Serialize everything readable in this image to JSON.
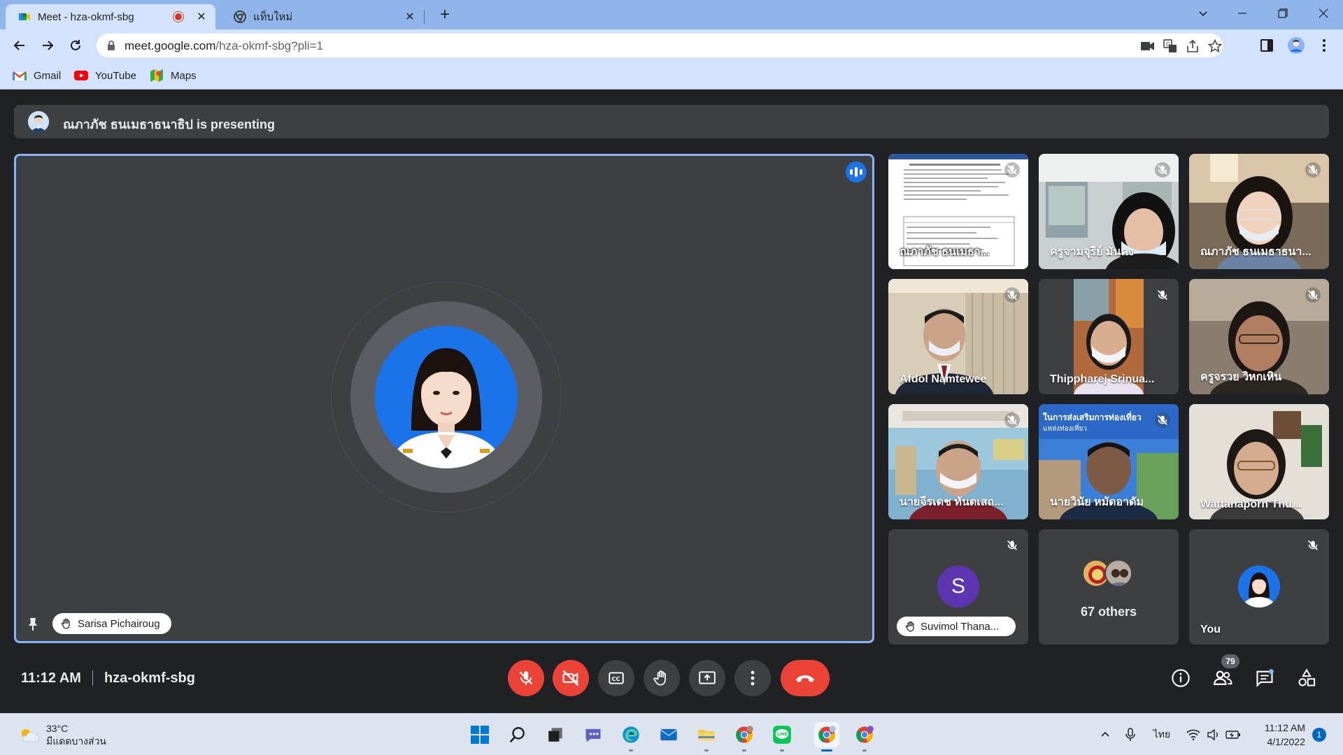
{
  "browser": {
    "tabs": [
      {
        "title": "Meet - hza-okmf-sbg",
        "active": true,
        "recording": true
      },
      {
        "title": "แท็บใหม่",
        "active": false
      }
    ],
    "url_host": "meet.google.com",
    "url_path": "/hza-okmf-sbg?pli=1",
    "bookmarks": [
      "Gmail",
      "YouTube",
      "Maps"
    ]
  },
  "meet": {
    "presenting_text": "ณภาภัช ธนเมธาธนาธิป is presenting",
    "main_speaker": "Sarisa Pichairoug",
    "tiles": [
      {
        "name": "ณภาภัช ธนเมธา...",
        "kind": "screen"
      },
      {
        "name": "ครูจามจุรีย์ มั่นคง",
        "kind": "video"
      },
      {
        "name": "ณภาภัช ธนเมธาธนา...",
        "kind": "video"
      },
      {
        "name": "Afdol Namtewee",
        "kind": "video"
      },
      {
        "name": "Thippharej Srinua...",
        "kind": "video"
      },
      {
        "name": "ครูจรวย วิหกเหิน",
        "kind": "video"
      },
      {
        "name": "นายจีรเดช ทันตเสถ...",
        "kind": "video"
      },
      {
        "name": "นายวินัย หมัดอาดัม",
        "kind": "video"
      },
      {
        "name": "Wattanaporn Thu...",
        "kind": "video"
      },
      {
        "name": "Suvimol Thana...",
        "kind": "avatar",
        "initial": "S"
      },
      {
        "name": "67 others",
        "kind": "others"
      },
      {
        "name": "You",
        "kind": "self"
      }
    ],
    "banner_text": "ในการส่งเสริมการท่องเที่ยว",
    "banner_subtext": "แหล่งท่องเที่ยว",
    "time": "11:12 AM",
    "meeting_code": "hza-okmf-sbg",
    "participant_count": "79"
  },
  "taskbar": {
    "temperature": "33°C",
    "weather": "มีแดดบางส่วน",
    "language": "ไทย",
    "time": "11:12 AM",
    "date": "4/1/2022",
    "notifications": "1"
  },
  "colors": {
    "meet_bg": "#202124",
    "tile_bg": "#3c4043",
    "active_border": "#8ab4f8",
    "danger": "#ea4335",
    "accent": "#1a73e8"
  }
}
